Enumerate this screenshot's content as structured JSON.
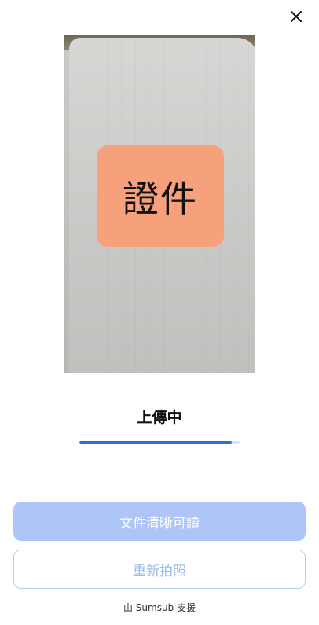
{
  "header": {
    "close_icon": "close-icon"
  },
  "preview": {
    "badge_label": "證件",
    "badge_color": "#f7a07c"
  },
  "status": {
    "title": "上傳中",
    "progress": 0.95
  },
  "actions": {
    "primary_label": "文件清晰可讀",
    "secondary_label": "重新拍照"
  },
  "footer": {
    "text": "由 Sumsub 支援"
  },
  "colors": {
    "accent": "#2c6fd6",
    "primary_button_disabled": "#adc6f7",
    "secondary_button_text": "#9ab8ee"
  }
}
